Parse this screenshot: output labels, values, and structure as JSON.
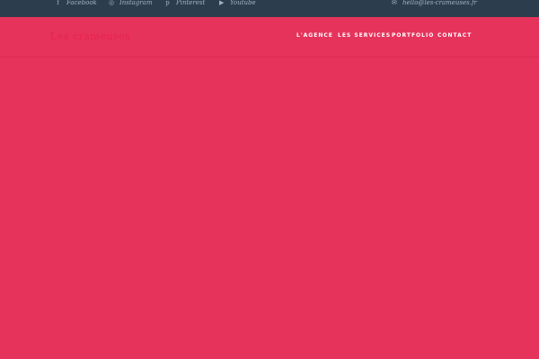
{
  "topbar": {
    "social": [
      {
        "label": "Facebook",
        "icon": "facebook-icon",
        "glyph": "f"
      },
      {
        "label": "Instagram",
        "icon": "instagram-icon",
        "glyph": "◎"
      },
      {
        "label": "Pinterest",
        "icon": "pinterest-icon",
        "glyph": "p"
      },
      {
        "label": "Youtube",
        "icon": "youtube-icon",
        "glyph": "▶"
      }
    ],
    "email": {
      "label": "hello@les-crameuses.fr",
      "icon": "mail-icon",
      "glyph": "✉"
    }
  },
  "header": {
    "logo": "Les crameuses",
    "nav": [
      {
        "label": "L'AGENCE"
      },
      {
        "label": "LES SERVICES"
      },
      {
        "label": "PORTFOLIO"
      },
      {
        "label": "CONTACT"
      }
    ]
  },
  "colors": {
    "topbar": "#2c3e4e",
    "accent": "#e6335c",
    "topbar_text": "#a3b1be"
  }
}
